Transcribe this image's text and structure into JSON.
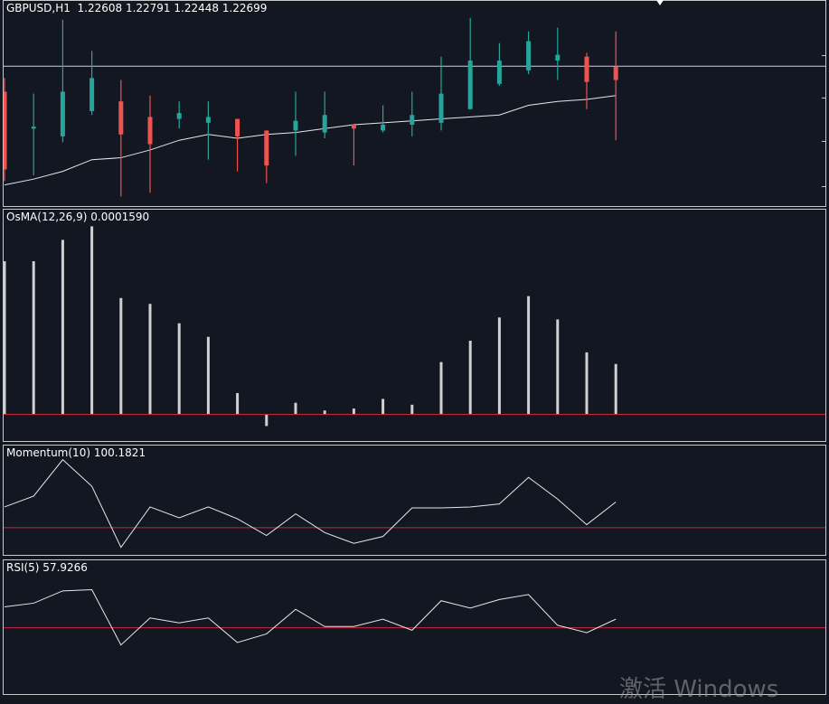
{
  "colors": {
    "background": "#131722",
    "bull": "#26a69a",
    "bear": "#ef5350",
    "line": "#e8e8e8",
    "zero_line": "#c8283c",
    "border": "#c8c8c8"
  },
  "chart_data": [
    {
      "type": "candlestick",
      "label": "GBPUSD,H1  1.22608 1.22791 1.22448 1.22699",
      "ylim": [
        0,
        100
      ],
      "horizontal_line": 70.1,
      "candles": [
        {
          "o": 57,
          "h": 64,
          "l": 11,
          "c": 17
        },
        {
          "o": 38,
          "h": 56,
          "l": 14,
          "c": 39
        },
        {
          "o": 34,
          "h": 94,
          "l": 31,
          "c": 57
        },
        {
          "o": 47,
          "h": 78,
          "l": 45,
          "c": 64
        },
        {
          "o": 52,
          "h": 63,
          "l": 3,
          "c": 35
        },
        {
          "o": 44,
          "h": 55,
          "l": 5,
          "c": 30
        },
        {
          "o": 43,
          "h": 52,
          "l": 38,
          "c": 46
        },
        {
          "o": 41,
          "h": 52,
          "l": 22,
          "c": 44
        },
        {
          "o": 43,
          "h": 43,
          "l": 16,
          "c": 34
        },
        {
          "o": 37,
          "h": 37,
          "l": 10,
          "c": 19
        },
        {
          "o": 37,
          "h": 57,
          "l": 24,
          "c": 42
        },
        {
          "o": 36,
          "h": 57,
          "l": 33,
          "c": 45
        },
        {
          "o": 40,
          "h": 40,
          "l": 19,
          "c": 38
        },
        {
          "o": 37,
          "h": 50,
          "l": 36,
          "c": 40
        },
        {
          "o": 40,
          "h": 57,
          "l": 34,
          "c": 45
        },
        {
          "o": 41,
          "h": 75,
          "l": 37,
          "c": 56
        },
        {
          "o": 48,
          "h": 95,
          "l": 48,
          "c": 73
        },
        {
          "o": 61,
          "h": 82,
          "l": 60,
          "c": 73
        },
        {
          "o": 68,
          "h": 88,
          "l": 66,
          "c": 83
        },
        {
          "o": 73,
          "h": 90,
          "l": 63,
          "c": 76
        },
        {
          "o": 75,
          "h": 77,
          "l": 48,
          "c": 62
        },
        {
          "o": 70,
          "h": 88,
          "l": 32,
          "c": 63
        }
      ],
      "ma": [
        9,
        12,
        16,
        22,
        23,
        27,
        32,
        35,
        33,
        35,
        36,
        38,
        40,
        41,
        42,
        43,
        44,
        45,
        50,
        52,
        53,
        55
      ]
    },
    {
      "type": "histogram",
      "label": "OsMA(12,26,9) 0.0001590",
      "ylim": [
        -10,
        100
      ],
      "zero_line": 0,
      "values": [
        79,
        79,
        90,
        97,
        60,
        57,
        47,
        40,
        11,
        -6,
        6,
        2,
        3,
        8,
        5,
        27,
        38,
        50,
        61,
        49,
        32,
        26
      ]
    },
    {
      "type": "line",
      "label": "Momentum(10) 100.1821",
      "ylim": [
        0,
        100
      ],
      "reference_line": 24,
      "values": [
        45,
        56,
        93,
        66,
        4,
        45,
        34,
        45,
        33,
        16,
        38,
        19,
        8,
        15,
        44,
        44,
        45,
        48,
        75,
        53,
        27,
        50
      ]
    },
    {
      "type": "line",
      "label": "RSI(5) 57.9266",
      "ylim": [
        0,
        100
      ],
      "reference_line": 51,
      "values": [
        68,
        71,
        81,
        82,
        37,
        59,
        55,
        59,
        39,
        46,
        66,
        52,
        52,
        58,
        49,
        73,
        67,
        74,
        78,
        53,
        47,
        58
      ]
    }
  ],
  "watermark": "激活 Windows"
}
